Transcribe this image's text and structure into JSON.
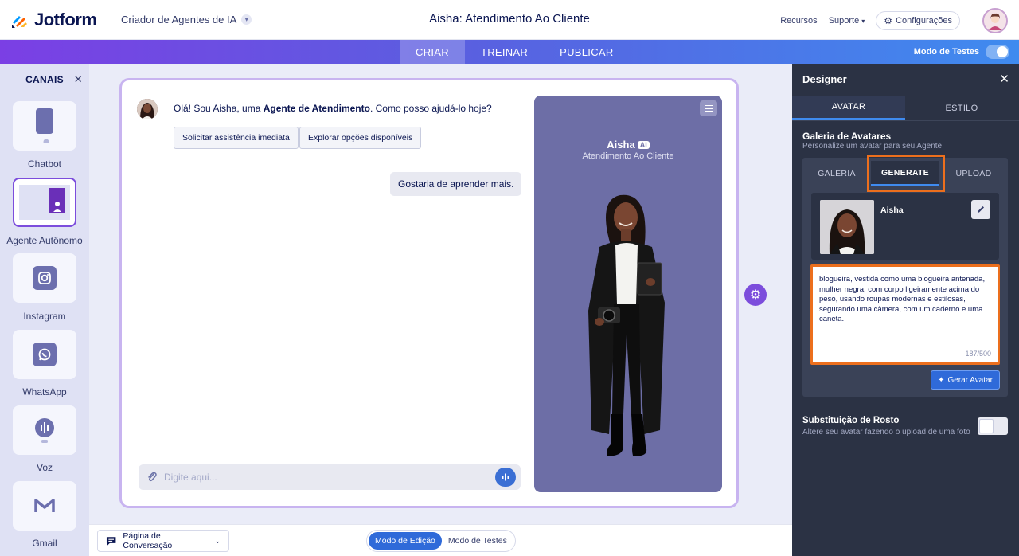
{
  "brand": {
    "name": "Jotform"
  },
  "header": {
    "breadcrumb": "Criador de Agentes de IA",
    "title": "Aisha: Atendimento Ao Cliente",
    "links": [
      "Recursos",
      "Suporte"
    ],
    "settings_label": "Configurações"
  },
  "navbar": {
    "tabs": [
      "CRIAR",
      "TREINAR",
      "PUBLICAR"
    ],
    "active_tab": "CRIAR",
    "test_mode_label": "Modo de Testes",
    "test_mode_on": false
  },
  "sidebar": {
    "title": "CANAIS",
    "channels": [
      {
        "label": "Chatbot",
        "icon": "chatbot-icon"
      },
      {
        "label": "Agente Autônomo",
        "icon": "agent-icon",
        "active": true
      },
      {
        "label": "Instagram",
        "icon": "instagram-icon"
      },
      {
        "label": "WhatsApp",
        "icon": "whatsapp-icon"
      },
      {
        "label": "Voz",
        "icon": "voice-icon"
      },
      {
        "label": "Gmail",
        "icon": "gmail-icon"
      }
    ]
  },
  "chat": {
    "greeting_pre": "Olá! Sou Aisha, uma ",
    "greeting_bold": "Agente de Atendimento",
    "greeting_post": ". Como posso ajudá-lo hoje?",
    "quick_replies": [
      "Solicitar assistência imediata",
      "Explorar opções disponíveis"
    ],
    "user_message": "Gostaria de aprender mais.",
    "input_placeholder": "Digite aqui..."
  },
  "preview": {
    "name": "Aisha",
    "badge": "AI",
    "subtitle": "Atendimento Ao Cliente"
  },
  "bottom": {
    "page_select": "Página de Conversação",
    "modes": [
      "Modo de Edição",
      "Modo de Testes"
    ],
    "active_mode": "Modo de Edição"
  },
  "designer": {
    "title": "Designer",
    "tabs": [
      "AVATAR",
      "ESTILO"
    ],
    "active_tab": "AVATAR",
    "gallery_title": "Galeria de Avatares",
    "gallery_subtitle": "Personalize um avatar para seu Agente",
    "gallery_tabs": [
      "GALERIA",
      "GENERATE",
      "UPLOAD"
    ],
    "active_gallery_tab": "GENERATE",
    "avatar_name": "Aisha",
    "prompt": "blogueira, vestida como uma blogueira antenada, mulher negra, com corpo ligeiramente acima do peso, usando roupas modernas e estilosas, segurando uma câmera, com um caderno e uma caneta.",
    "char_count": "187/500",
    "generate_button": "Gerar Avatar",
    "face_title": "Substituição de Rosto",
    "face_subtitle": "Altere seu avatar fazendo o upload de uma foto",
    "face_toggle_on": false
  },
  "colors": {
    "accent": "#7c4ddc",
    "primary_blue": "#2f6ad9",
    "highlight_orange": "#ec6f1d",
    "panel_dark": "#2b3244"
  }
}
